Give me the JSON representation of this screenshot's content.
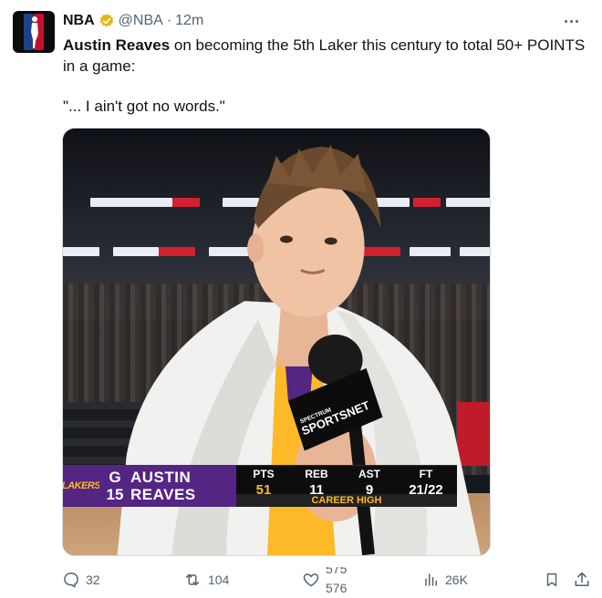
{
  "account": {
    "name": "NBA",
    "handle": "@NBA",
    "separator": "·",
    "time": "12m",
    "logo_text": "NBA"
  },
  "tweet": {
    "bold": "Austin Reaves",
    "rest": " on becoming the 5th Laker this century to total 50+ POINTS in a game:",
    "quote": "\"... I ain't got no words.\""
  },
  "graphic": {
    "team_logo": "LAKERS",
    "position": "G",
    "number": "15",
    "first_name": "AUSTIN",
    "last_name": "REAVES",
    "stats": [
      {
        "label": "PTS",
        "value": "51"
      },
      {
        "label": "REB",
        "value": "11"
      },
      {
        "label": "AST",
        "value": "9"
      },
      {
        "label": "FT",
        "value": "21/22"
      }
    ],
    "career": "CAREER HIGH",
    "mic_brand_top": "SPECTRUM",
    "mic_brand": "SPORTSNET"
  },
  "stats_bar": {
    "replies": "32",
    "reposts": "104",
    "likes_top": "575",
    "likes_bottom": "576",
    "views": "26K"
  },
  "icons": {
    "verified": "verified-badge-icon",
    "more": "more-icon",
    "reply": "reply-icon",
    "repost": "repost-icon",
    "like": "heart-icon",
    "views": "views-icon",
    "bookmark": "bookmark-icon",
    "share": "share-icon"
  },
  "colors": {
    "lakers_purple": "#552583",
    "lakers_gold": "#fdb927",
    "verified_gold": "#e2b719",
    "muted": "#536471"
  }
}
